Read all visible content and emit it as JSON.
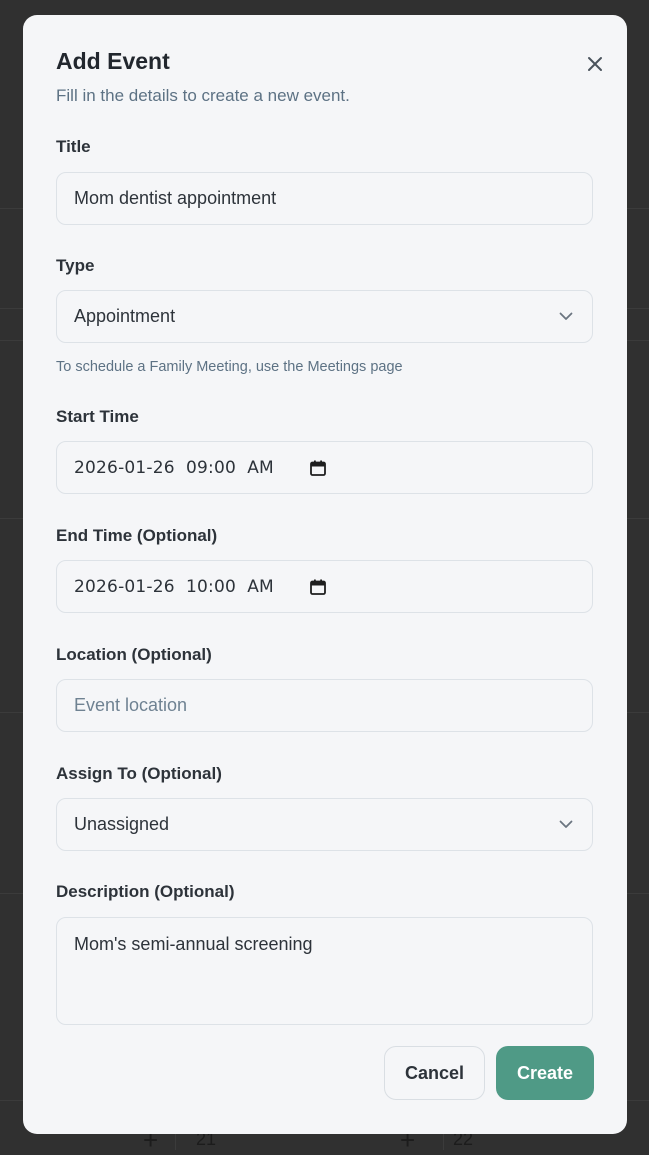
{
  "modal": {
    "title": "Add Event",
    "subtitle": "Fill in the details to create a new event."
  },
  "fields": {
    "title": {
      "label": "Title",
      "value": "Mom dentist appointment"
    },
    "type": {
      "label": "Type",
      "value": "Appointment",
      "hint": "To schedule a Family Meeting, use the Meetings page"
    },
    "start_time": {
      "label": "Start Time",
      "value": "2026-01-26  09:00  AM"
    },
    "end_time": {
      "label": "End Time (Optional)",
      "value": "2026-01-26  10:00  AM"
    },
    "location": {
      "label": "Location (Optional)",
      "value": "",
      "placeholder": "Event location"
    },
    "assign_to": {
      "label": "Assign To (Optional)",
      "value": "Unassigned"
    },
    "description": {
      "label": "Description (Optional)",
      "value": "Mom's semi-annual screening"
    }
  },
  "buttons": {
    "cancel": "Cancel",
    "create": "Create"
  },
  "background": {
    "cell_left": "21",
    "cell_right": "22"
  },
  "colors": {
    "accent": "#4f9a86",
    "overlay": "#303030",
    "surface": "#f5f6f8"
  },
  "icons": {
    "close": "close-icon",
    "chevron": "chevron-down-icon",
    "calendar": "calendar-icon"
  }
}
